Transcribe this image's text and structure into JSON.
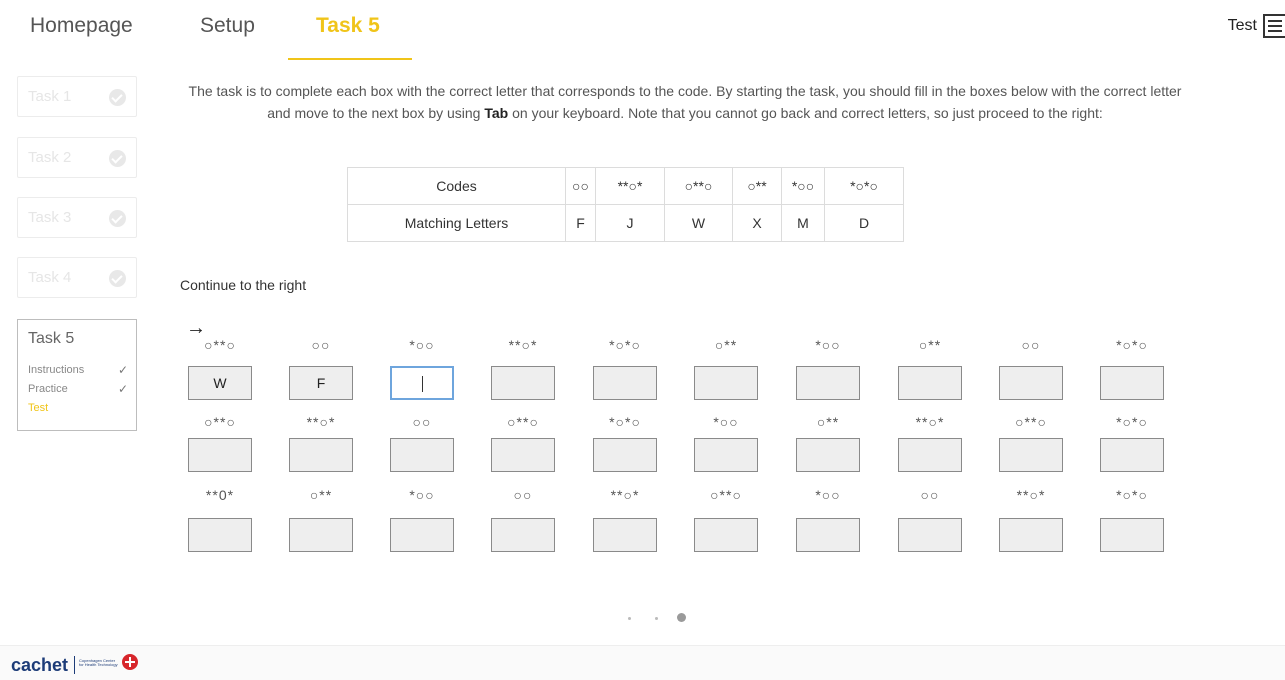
{
  "nav": {
    "homepage": "Homepage",
    "setup": "Setup",
    "task5": "Task 5",
    "user": "Test",
    "user_icon": "list-settings-icon",
    "accent_color": "#f0c419"
  },
  "sidebar": {
    "tasks": [
      {
        "label": "Task 1",
        "done": true
      },
      {
        "label": "Task 2",
        "done": true
      },
      {
        "label": "Task 3",
        "done": true
      },
      {
        "label": "Task 4",
        "done": true
      }
    ],
    "active": {
      "title": "Task 5",
      "items": [
        {
          "label": "Instructions",
          "done": true,
          "tick": "✓"
        },
        {
          "label": "Practice",
          "done": true,
          "tick": "✓"
        },
        {
          "label": "Test",
          "done": false,
          "current": true
        }
      ]
    }
  },
  "instructions": {
    "before_bold": "The task is to complete each box with the correct letter that corresponds to the code. By starting the task, you should fill in the boxes below with the correct letter and move to the next box by using ",
    "bold": "Tab",
    "after_bold": " on your keyboard. Note that you cannot go back and correct letters, so just proceed to the right:"
  },
  "key_table": {
    "codes_label": "Codes",
    "letters_label": "Matching Letters",
    "codes": [
      "○○",
      "**○*",
      "○**○",
      "○**",
      "*○○",
      "*○*○"
    ],
    "letters": [
      "F",
      "J",
      "W",
      "X",
      "M",
      "D"
    ]
  },
  "continue_label": "Continue to the right",
  "arrow": "→",
  "grid": {
    "rows": [
      {
        "codes": [
          "○**○",
          "○○",
          "*○○",
          "**○*",
          "*○*○",
          "○**",
          "*○○",
          "○**",
          "○○",
          "*○*○"
        ],
        "values": [
          "W",
          "F",
          "",
          "",
          "",
          "",
          "",
          "",
          "",
          ""
        ]
      },
      {
        "codes": [
          "○**○",
          "**○*",
          "○○",
          "○**○",
          "*○*○",
          "*○○",
          "○**",
          "**○*",
          "○**○",
          "*○*○"
        ],
        "values": [
          "",
          "",
          "",
          "",
          "",
          "",
          "",
          "",
          "",
          ""
        ]
      },
      {
        "codes": [
          "**0*",
          "○**",
          "*○○",
          "○○",
          "**○*",
          "○**○",
          "*○○",
          "○○",
          "**○*",
          "*○*○"
        ],
        "values": [
          "",
          "",
          "",
          "",
          "",
          "",
          "",
          "",
          "",
          ""
        ]
      }
    ],
    "focused": {
      "row": 0,
      "col": 2
    }
  },
  "pager": {
    "pages": 3,
    "current": 3
  },
  "footer": {
    "logo": "cachet",
    "partner_text": "Copenhagen Center for Health Technology"
  }
}
